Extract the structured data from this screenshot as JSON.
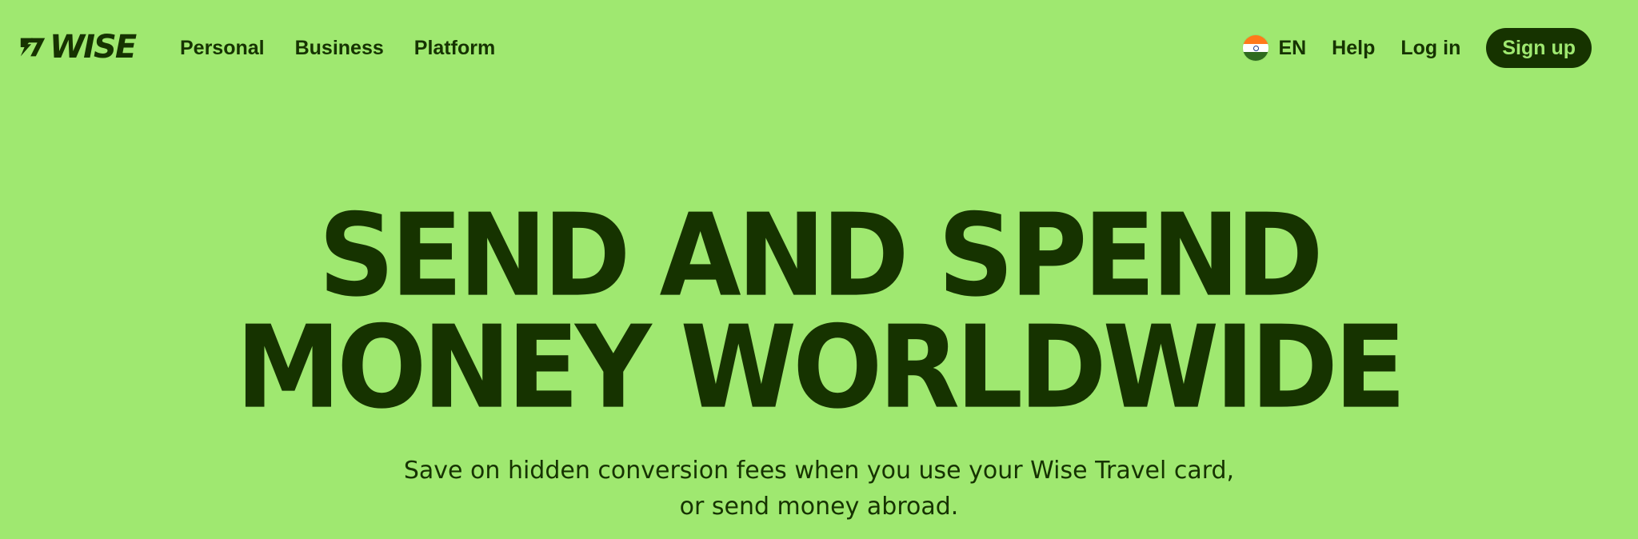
{
  "brand": {
    "logo_text": "WISE",
    "text_color": "#163300",
    "background_color": "#9fe870"
  },
  "nav": {
    "left_items": [
      {
        "label": "Personal"
      },
      {
        "label": "Business"
      },
      {
        "label": "Platform"
      }
    ],
    "language": {
      "label": "EN",
      "flag_icon": "india-flag-icon"
    },
    "help_label": "Help",
    "login_label": "Log in",
    "signup_label": "Sign up"
  },
  "hero": {
    "title_line1": "SEND AND SPEND",
    "title_line2": "MONEY WORLDWIDE",
    "subtitle_line1": "Save on hidden conversion fees when you use your Wise Travel card,",
    "subtitle_line2": "or send money abroad."
  }
}
